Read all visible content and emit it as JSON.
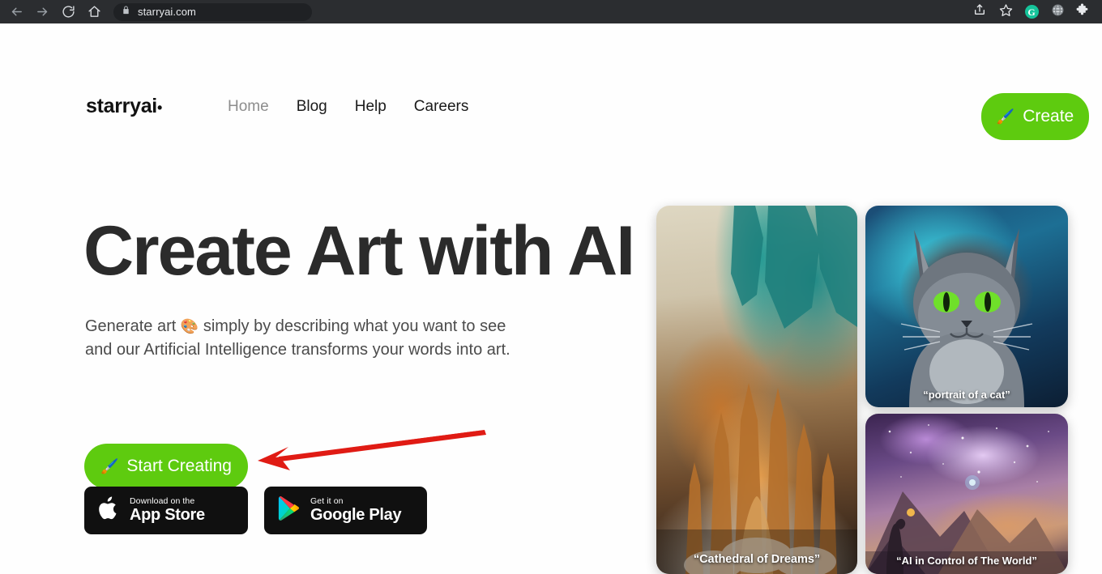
{
  "browser": {
    "back_icon": "back-arrow-icon",
    "forward_icon": "forward-arrow-icon",
    "reload_icon": "reload-icon",
    "home_icon": "home-icon",
    "lock_icon": "lock-icon",
    "url": "starryai.com",
    "share_icon": "share-icon",
    "bookmark_icon": "star-bookmark-icon",
    "grammarly_letter": "G",
    "globe_icon": "globe-icon",
    "extensions_icon": "puzzle-piece-icon"
  },
  "site": {
    "logo": "starryai",
    "logo_dot": "•",
    "nav": [
      {
        "label": "Home",
        "active": true
      },
      {
        "label": "Blog",
        "active": false
      },
      {
        "label": "Help",
        "active": false
      },
      {
        "label": "Careers",
        "active": false
      }
    ],
    "create_button": {
      "label": "Create",
      "icon": "🖌️",
      "color": "#5ecb0f"
    }
  },
  "hero": {
    "title": "Create Art with AI",
    "subtitle_line1_before": "Generate art",
    "subtitle_emoji": "🎨",
    "subtitle_line1_after": "simply by describing what you want to see",
    "subtitle_line2": "and our Artificial Intelligence transforms your words into art.",
    "start_button": {
      "label": "Start Creating",
      "icon": "🖌️",
      "color": "#5ecb0f"
    }
  },
  "store_badges": [
    {
      "icon": "apple-logo-icon",
      "small": "Download on the",
      "big": "App Store"
    },
    {
      "icon": "google-play-icon",
      "small": "Get it on",
      "big": "Google Play"
    }
  ],
  "gallery": [
    {
      "name": "card-cathedral",
      "caption": "“Cathedral of Dreams”"
    },
    {
      "name": "card-cat",
      "caption": "“portrait of a cat”"
    },
    {
      "name": "card-space",
      "caption": "“AI in Control of The World”"
    }
  ],
  "annotation": {
    "type": "red-arrow",
    "color": "#e01b14",
    "points_to": "start-creating-button"
  }
}
